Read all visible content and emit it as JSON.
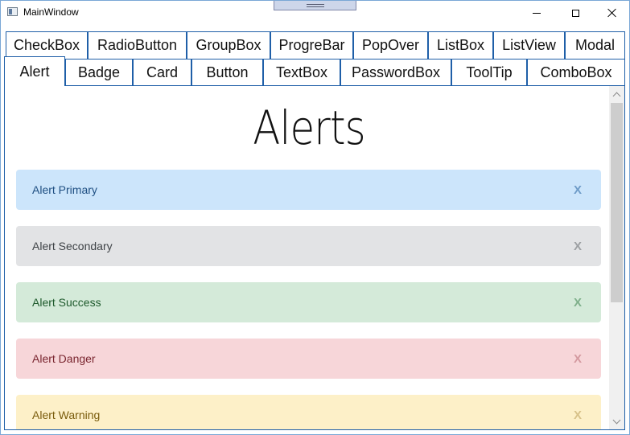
{
  "window": {
    "title": "MainWindow",
    "icon": "app-window-icon",
    "controls": [
      "minimize-icon",
      "maximize-icon",
      "close-icon"
    ]
  },
  "tabs_row1": [
    {
      "label": "CheckBox"
    },
    {
      "label": "RadioButton"
    },
    {
      "label": "GroupBox"
    },
    {
      "label": "ProgreBar"
    },
    {
      "label": "PopOver"
    },
    {
      "label": "ListBox"
    },
    {
      "label": "ListView"
    },
    {
      "label": "Modal"
    }
  ],
  "tabs_row2": [
    {
      "label": "Alert",
      "selected": true
    },
    {
      "label": "Badge"
    },
    {
      "label": "Card"
    },
    {
      "label": "Button"
    },
    {
      "label": "TextBox"
    },
    {
      "label": "PasswordBox"
    },
    {
      "label": "ToolTip"
    },
    {
      "label": "ComboBox"
    }
  ],
  "content": {
    "heading": "Alerts",
    "alerts": [
      {
        "label": "Alert Primary",
        "close": "X",
        "bg": "#cce5fb",
        "text": "#1f4f82",
        "x": "#6f9cc8"
      },
      {
        "label": "Alert Secondary",
        "close": "X",
        "bg": "#e2e3e5",
        "text": "#3f4347",
        "x": "#9da0a3"
      },
      {
        "label": "Alert Success",
        "close": "X",
        "bg": "#d4ead9",
        "text": "#1e5a2c",
        "x": "#7fb08b"
      },
      {
        "label": "Alert Danger",
        "close": "X",
        "bg": "#f7d6d9",
        "text": "#7a2630",
        "x": "#d49aa0"
      },
      {
        "label": "Alert Warning",
        "close": "X",
        "bg": "#fdf0c8",
        "text": "#7a5c0d",
        "x": "#d8c28a"
      }
    ]
  },
  "colors": {
    "tab_border": "#1f5fa8",
    "scrollbar_track": "#f0f0f0",
    "scrollbar_thumb": "#cdcdcd"
  }
}
